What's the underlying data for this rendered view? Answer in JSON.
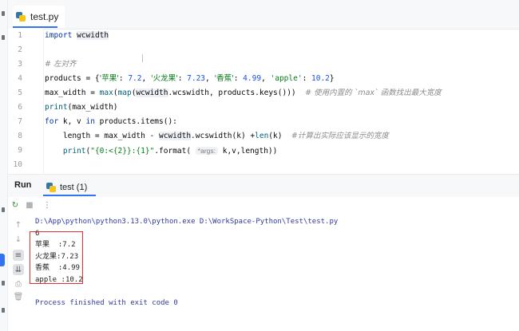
{
  "editor": {
    "tab": {
      "filename": "test.py",
      "icon": "python-file-icon"
    },
    "line_numbers": [
      "1",
      "2",
      "3",
      "4",
      "5",
      "6",
      "7",
      "8",
      "9",
      "10"
    ],
    "code": {
      "l1_kw": "import",
      "l1_mod": "wcwidth",
      "l3_comment": "# 左对齐",
      "l4_a": "products = {",
      "l4_s1": "'苹果'",
      "l4_c1": ": ",
      "l4_n1": "7.2",
      "l4_c2": ", ",
      "l4_s2": "'火龙果'",
      "l4_c3": ": ",
      "l4_n2": "7.23",
      "l4_c4": ", ",
      "l4_s3": "'香蕉'",
      "l4_c5": ": ",
      "l4_n3": "4.99",
      "l4_c6": ", ",
      "l4_s4": "'apple'",
      "l4_c7": ": ",
      "l4_n4": "10.2",
      "l4_end": "}",
      "l5_a": "max_width = ",
      "l5_fn1": "max",
      "l5_b": "(",
      "l5_fn2": "map",
      "l5_c": "(",
      "l5_mod": "wcwidth",
      "l5_d": ".wcswidth, products.keys()))  ",
      "l5_comment": "# 使用内置的 `max` 函数找出最大宽度",
      "l6_fn": "print",
      "l6_rest": "(max_width)",
      "l7_kw1": "for",
      "l7_a": " k, v ",
      "l7_kw2": "in",
      "l7_b": " products.items():",
      "l8_a": "    length = max_width - ",
      "l8_mod": "wcwidth",
      "l8_b": ".wcswidth(k) +",
      "l8_fn": "len",
      "l8_c": "(k)  ",
      "l8_comment": "#计算出实际应该显示的宽度",
      "l9_a": "    ",
      "l9_fn": "print",
      "l9_b": "(",
      "l9_str": "\"{0:<{2}}:{1}\"",
      "l9_c": ".format( ",
      "l9_hint": "*args:",
      "l9_d": " k,v,length))"
    }
  },
  "run": {
    "title": "Run",
    "tab_label": "test (1)",
    "toolbar": {
      "rerun_icon": "rerun-icon",
      "stop_icon": "stop-icon",
      "more_icon": "more-options-icon"
    },
    "output": {
      "command": "D:\\App\\python\\python3.13.0\\python.exe D:\\WorkSpace-Python\\Test\\test.py",
      "line_max": "6",
      "rows": [
        {
          "key": "苹果",
          "sep": "  :",
          "value": "7.2"
        },
        {
          "key": "火龙果",
          "sep": ":",
          "value": "7.23"
        },
        {
          "key": "香蕉",
          "sep": "  :",
          "value": "4.99"
        },
        {
          "key": "apple",
          "sep": " :",
          "value": "10.2"
        }
      ],
      "exit_message": "Process finished with exit code 0"
    }
  },
  "colors": {
    "accent": "#3574f0",
    "highlight_box": "#e03030",
    "keyword": "#0033b3",
    "string": "#067d17",
    "number": "#1750eb"
  }
}
